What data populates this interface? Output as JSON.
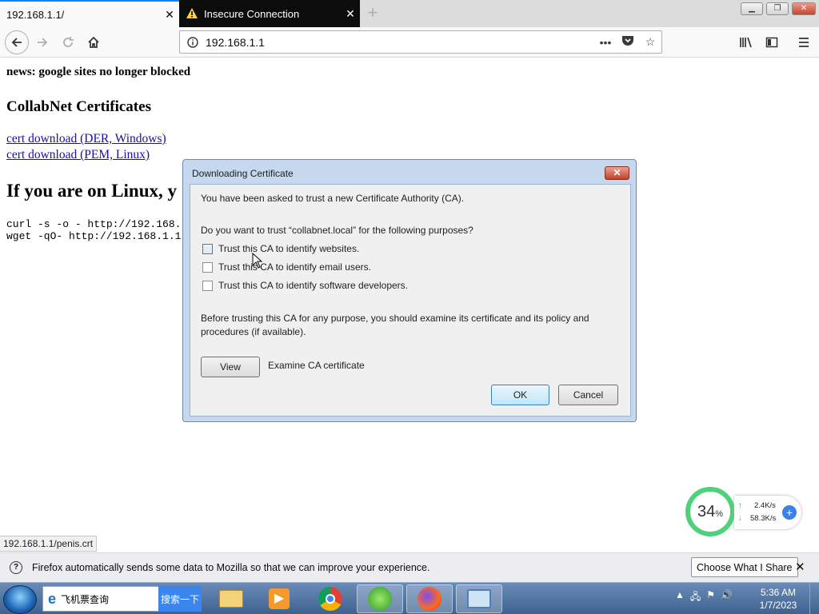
{
  "browser": {
    "tabs": [
      {
        "label": "192.168.1.1/"
      },
      {
        "label": "Insecure Connection"
      }
    ],
    "url": "192.168.1.1",
    "status_url": "192.168.1.1/penis.crt"
  },
  "page": {
    "news": "news: google sites no longer blocked",
    "heading": "CollabNet Certificates",
    "links": [
      "cert download (DER, Windows)",
      "cert download (PEM, Linux)"
    ],
    "linux_heading": "If you are on Linux, y",
    "code_lines": [
      "curl -s -o - http://192.168.",
      "wget -qO- http://192.168.1.1"
    ]
  },
  "dialog": {
    "title": "Downloading Certificate",
    "intro": "You have been asked to trust a new Certificate Authority (CA).",
    "question": "Do you want to trust “collabnet.local” for the following purposes?",
    "options": [
      {
        "label": "Trust this CA to identify websites.",
        "checked": false
      },
      {
        "label": "Trust this CA to identify email users.",
        "checked": false
      },
      {
        "label": "Trust this CA to identify software developers.",
        "checked": false
      }
    ],
    "advice": "Before trusting this CA for any purpose, you should examine its certificate and its policy and procedures (if available).",
    "view_label": "View",
    "view_desc": "Examine CA certificate",
    "ok_label": "OK",
    "cancel_label": "Cancel"
  },
  "notice": {
    "text": "Firefox automatically sends some data to Mozilla so that we can improve your experience.",
    "button": "Choose What I Share"
  },
  "speed_widget": {
    "percent": "34",
    "percent_unit": "%",
    "up": "2.4K/s",
    "down": "58.3K/s"
  },
  "taskbar": {
    "search_text": "飞机票查询",
    "search_button": "搜索一下",
    "time": "5:36 AM",
    "date": "1/7/2023"
  },
  "icons": [
    "warning-icon",
    "back-icon",
    "forward-icon",
    "reload-icon",
    "home-icon",
    "info-icon",
    "more-icon",
    "pocket-icon",
    "star-icon",
    "library-icon",
    "sidebar-icon",
    "menu-icon"
  ]
}
